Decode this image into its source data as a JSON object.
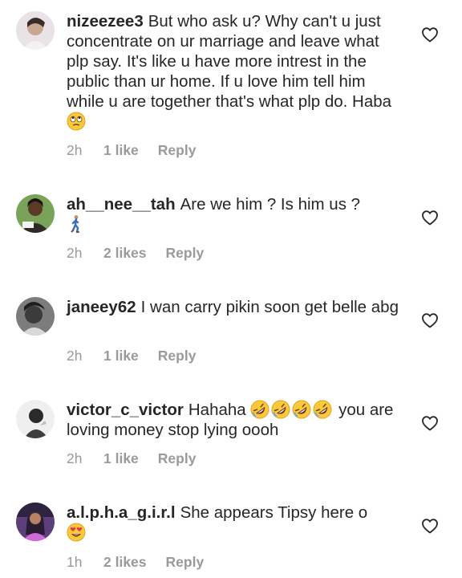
{
  "comments": [
    {
      "username": "nizeezee3",
      "text": "But who ask u? Why can't u just concentrate on ur marriage and leave what plp say. It's like u have more intrest in the public than ur home. If u love him tell him while u are together that's what plp do. Haba",
      "emoji_after": "face-with-rolling-eyes",
      "time": "2h",
      "likes": "1 like",
      "reply": "Reply"
    },
    {
      "username": "ah__nee__tah",
      "text": "Are we him ? Is him us ?",
      "emoji_after": "person-walking",
      "time": "2h",
      "likes": "2 likes",
      "reply": "Reply"
    },
    {
      "username": "janeey62",
      "text": "I wan carry pikin soon get belle abg",
      "time": "2h",
      "likes": "1 like",
      "reply": "Reply"
    },
    {
      "username": "victor_c_victor",
      "text_before": "Hahaha",
      "emojis": [
        "rolling-on-floor-laughing",
        "rolling-on-floor-laughing",
        "rolling-on-floor-laughing",
        "rolling-on-floor-laughing"
      ],
      "text_after": "you are loving money stop lying oooh",
      "time": "2h",
      "likes": "1 like",
      "reply": "Reply"
    },
    {
      "username": "a.l.p.h.a_g.i.r.l",
      "text": "She appears Tipsy here o",
      "emoji_after": "smiling-face-with-heart-eyes",
      "time": "1h",
      "likes": "2 likes",
      "reply": "Reply"
    }
  ],
  "colors": {
    "text": "#262626",
    "meta": "#9a9a9a",
    "heart_outline": "#262626"
  }
}
